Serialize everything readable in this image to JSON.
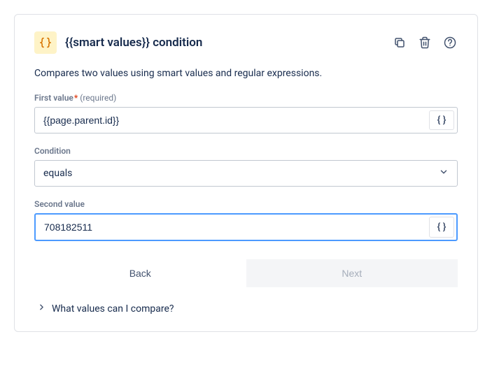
{
  "header": {
    "title": "{{smart values}} condition"
  },
  "description": "Compares two values using smart values and regular expressions.",
  "firstValue": {
    "label": "First value",
    "requiredStar": "*",
    "requiredText": "(required)",
    "value": "{{page.parent.id}}"
  },
  "condition": {
    "label": "Condition",
    "selected": "equals"
  },
  "secondValue": {
    "label": "Second value",
    "value": "708182511"
  },
  "buttons": {
    "back": "Back",
    "next": "Next"
  },
  "help": {
    "label": "What values can I compare?"
  },
  "glyphs": {
    "braces": "{ }"
  }
}
